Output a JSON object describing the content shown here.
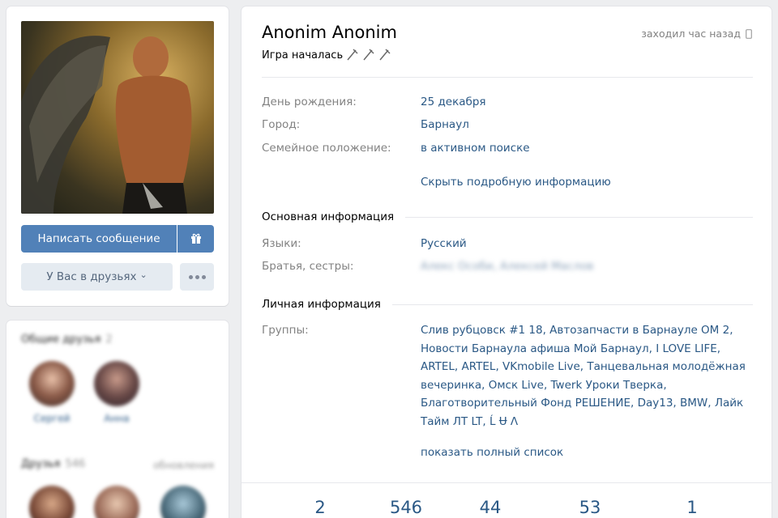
{
  "profile": {
    "name": "Anonim Anonim",
    "status_text": "Игра началась",
    "last_seen": "заходил час назад"
  },
  "actions": {
    "message_button": "Написать сообщение",
    "friend_button": "У Вас в друзьях",
    "friend_chevron": "⌄"
  },
  "info": {
    "rows": [
      {
        "label": "День рождения:",
        "value": "25 декабря"
      },
      {
        "label": "Город:",
        "value": "Барнаул"
      },
      {
        "label": "Семейное положение:",
        "value": "в активном поиске"
      }
    ],
    "hide_details_link": "Скрыть подробную информацию",
    "main_section_title": "Основная информация",
    "main_rows": [
      {
        "label": "Языки:",
        "value": "Русский"
      },
      {
        "label": "Братья, сестры:",
        "value": "Алекс Особи, Алексей Маслов"
      }
    ],
    "personal_section_title": "Личная информация",
    "groups_label": "Группы:",
    "groups_value": "Слив рубцовск #1 18, Автозапчасти в Барнауле ОМ 2, Новости Барнаула афиша Мой Барнаул, I LOVE LIFE, ARTEL, ARTEL, VKmobile Live, Танцевальная молодёжная вечеринка, Омск Live, Twerk Уроки Тверка, Благотворительный Фонд РЕШЕНИЕ, Day13, BMW, Лайк Тайм ЛТ LT, Ĺ Ʉ Λ",
    "show_full_list_link": "показать полный список"
  },
  "counters": [
    "2",
    "546",
    "44",
    "53",
    "1"
  ],
  "left_blocks": {
    "mutual_friends_title": "Общие друзья",
    "mutual_friends_count": "2",
    "mutual_friends": [
      {
        "name": "Сергей"
      },
      {
        "name": "Анна"
      }
    ],
    "friends_title": "Друзья",
    "friends_count": "546",
    "friends_all": "обновления"
  },
  "icons": {
    "gift": "gift-icon",
    "more": "more-icon",
    "phone": "phone-icon",
    "pin": "pin-icon"
  },
  "colors": {
    "accent": "#5181b8",
    "link": "#2a5885",
    "label": "#828282",
    "background": "#edeef0"
  }
}
